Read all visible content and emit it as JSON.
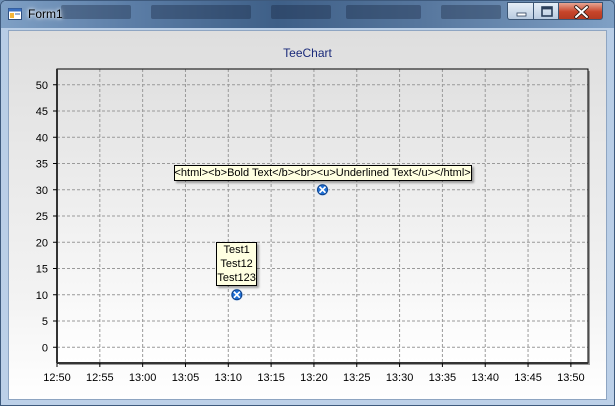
{
  "window": {
    "title": "Form1",
    "icon": "form-app-icon",
    "controls": [
      "minimize-icon",
      "maximize-icon",
      "close-icon"
    ]
  },
  "chart_data": {
    "type": "scatter",
    "title": "TeeChart",
    "xlabel": "",
    "ylabel": "",
    "xlim": [
      "12:50",
      "13:52"
    ],
    "ylim": [
      -3,
      53
    ],
    "x_ticks": [
      "12:50",
      "12:55",
      "13:00",
      "13:05",
      "13:10",
      "13:15",
      "13:20",
      "13:25",
      "13:30",
      "13:35",
      "13:40",
      "13:45",
      "13:50"
    ],
    "y_ticks": [
      0,
      5,
      10,
      15,
      20,
      25,
      30,
      35,
      40,
      45,
      50
    ],
    "grid": true,
    "series": [
      {
        "points": [
          {
            "x": "13:11",
            "y": 10,
            "label": [
              "Test1",
              "Test12",
              "Test123"
            ]
          },
          {
            "x": "13:21",
            "y": 30,
            "label": [
              "<html><b>Bold Text</b><br><u>Underlined Text</u></html>"
            ]
          }
        ]
      }
    ],
    "point_color": "#1e6fd6"
  }
}
